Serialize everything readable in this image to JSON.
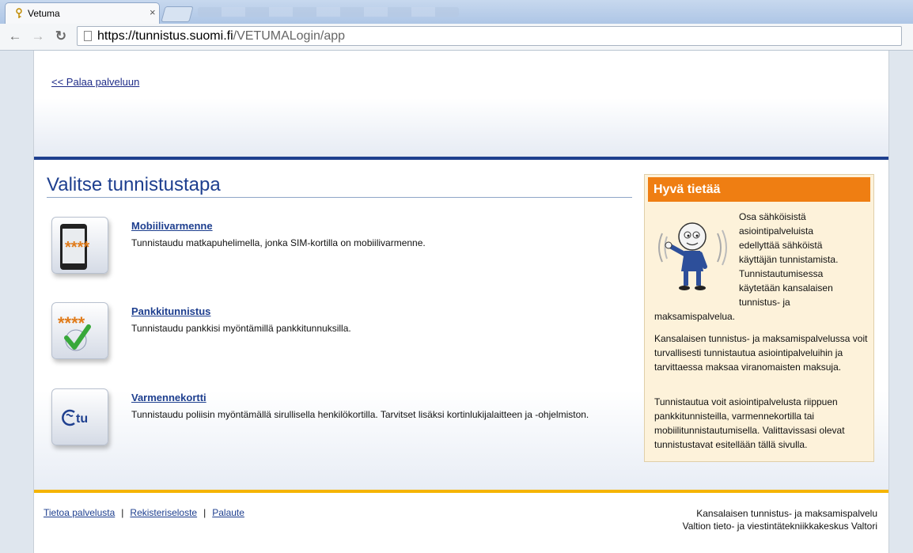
{
  "browser": {
    "tab_title": "Vetuma",
    "tab_close": "×",
    "url_host": "https://tunnistus.suomi.fi",
    "url_path": "/VETUMALogin/app",
    "back_glyph": "←",
    "forward_glyph": "→",
    "reload_glyph": "↻"
  },
  "header": {
    "back_link": "<< Palaa palveluun"
  },
  "main": {
    "heading": "Valitse tunnistustapa",
    "methods": [
      {
        "title": "Mobiilivarmenne",
        "description": "Tunnistaudu matkapuhelimella, jonka SIM-kortilla on mobiilivarmenne.",
        "icon": "mobile-phone-icon",
        "stars": "****"
      },
      {
        "title": "Pankkitunnistus",
        "description": "Tunnistaudu pankkisi myöntämillä pankkitunnuksilla.",
        "icon": "bank-checkmark-icon",
        "stars": "****"
      },
      {
        "title": "Varmennekortti",
        "description": "Tunnistaudu poliisin myöntämällä sirullisella henkilökortilla. Tarvitset lisäksi kortinlukijalaitteen ja -ohjelmiston.",
        "icon": "id-card-tu-icon",
        "logo_text": "tu"
      }
    ]
  },
  "info": {
    "title": "Hyvä tietää",
    "p1": "Osa sähköisistä asiointipalveluista edellyttää sähköistä käyttäjän tunnistamista. Tunnistautumisessa käytetään kansalaisen tunnistus- ja maksamispalvelua.",
    "p1_lines": [
      "Osa sähköisistä",
      "asiointipalveluista",
      "edellyttää sähköistä",
      "käyttäjän tunnistamista.",
      "Tunnistautumisessa",
      "käytetään kansalaisen",
      "tunnistus- ja"
    ],
    "p1_last": "maksamispalvelua.",
    "p2": "Kansalaisen tunnistus- ja maksamispalvelussa voit turvallisesti tunnistautua asiointipalveluihin ja tarvittaessa maksaa viranomaisten maksuja.",
    "p3": "Tunnistautua voit asiointipalvelusta riippuen pankkitunnisteilla, varmennekortilla tai mobiilitunnistautumisella. Valittavissasi olevat tunnistustavat esitellään tällä sivulla."
  },
  "footer": {
    "links": [
      "Tietoa palvelusta",
      "Rekisteriseloste",
      "Palaute"
    ],
    "separator": "|",
    "right_line1": "Kansalaisen tunnistus- ja maksamispalvelu",
    "right_line2": "Valtion tieto- ja viestintätekniikkakeskus Valtori"
  },
  "colors": {
    "primary_blue": "#1e3f8f",
    "orange": "#ef7e12",
    "yellow": "#f5b400",
    "info_bg": "#fdf2da"
  }
}
